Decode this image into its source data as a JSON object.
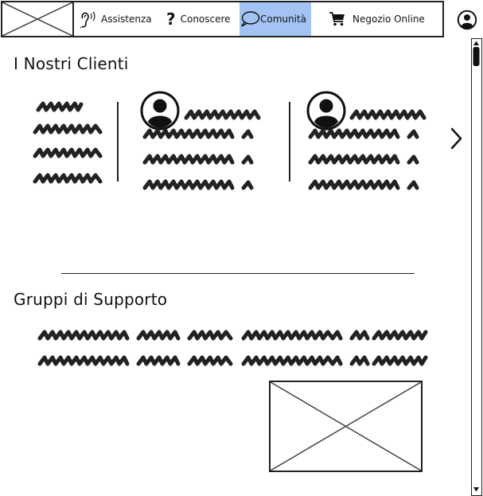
{
  "nav": {
    "items": [
      {
        "label": "Assistenza",
        "icon": "ear-icon",
        "active": false
      },
      {
        "label": "Conoscere",
        "icon": "question-mark-icon",
        "active": false
      },
      {
        "label": "Comunità",
        "icon": "speech-bubble-icon",
        "active": true
      },
      {
        "label": "Negozio Online",
        "icon": "shopping-cart-icon",
        "active": false
      }
    ]
  },
  "sections": {
    "clients_title": "I Nostri Clienti",
    "support_title": "Gruppi di Supporto"
  },
  "colors": {
    "active_nav_bg": "#a3c4f3",
    "ink": "#222222"
  }
}
